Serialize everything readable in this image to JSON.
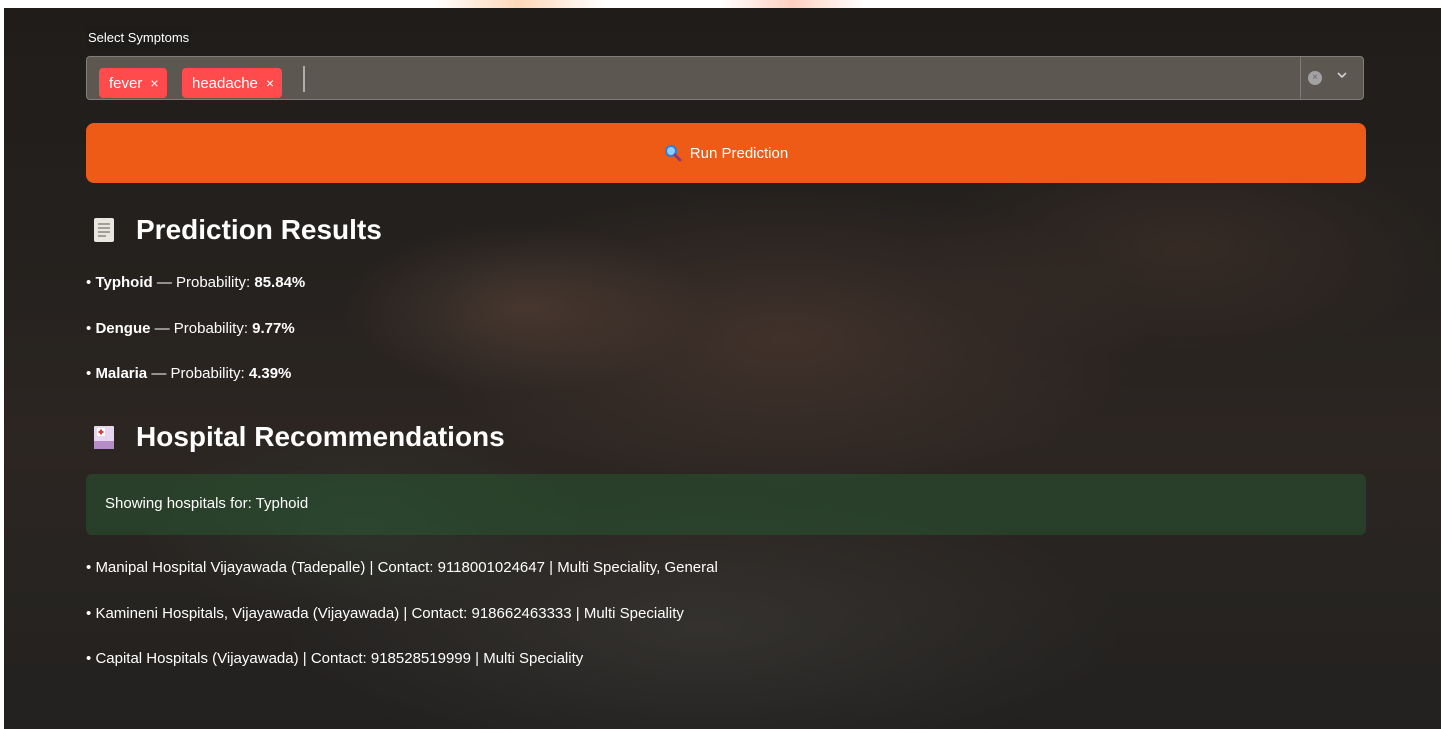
{
  "select_label": "Select Symptoms",
  "multiselect": {
    "tags": [
      {
        "label": "fever",
        "remove": "×"
      },
      {
        "label": "headache",
        "remove": "×"
      }
    ],
    "clear_glyph": "×",
    "tag_color": "#ff4b4b"
  },
  "run_button": {
    "label": "Run Prediction",
    "icon": "magnifier-icon",
    "color": "#ee5b17"
  },
  "prediction": {
    "title": "Prediction Results",
    "icon": "receipt-icon",
    "prefix": "— Probability: ",
    "bullet": "•",
    "results": [
      {
        "disease": "Typhoid",
        "probability": "85.84%"
      },
      {
        "disease": "Dengue",
        "probability": "9.77%"
      },
      {
        "disease": "Malaria",
        "probability": "4.39%"
      }
    ]
  },
  "hospitals": {
    "title": "Hospital Recommendations",
    "icon": "hospital-icon",
    "info_text": "Showing hospitals for: Typhoid",
    "contact_label": "Contact:",
    "items": [
      {
        "name": "Manipal Hospital Vijayawada (Tadepalle)",
        "contact": "9118001024647",
        "type": "Multi Speciality, General"
      },
      {
        "name": "Kamineni Hospitals, Vijayawada (Vijayawada)",
        "contact": "918662463333",
        "type": "Multi Speciality"
      },
      {
        "name": "Capital Hospitals (Vijayawada)",
        "contact": "918528519999",
        "type": "Multi Speciality"
      }
    ]
  }
}
